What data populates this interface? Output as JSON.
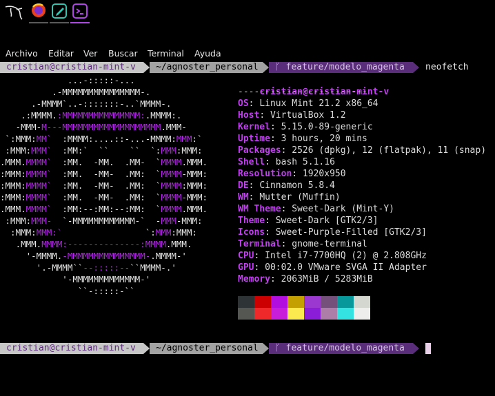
{
  "taskbar": {
    "items": [
      {
        "name": "kali-dragon-icon"
      },
      {
        "name": "firefox-icon"
      },
      {
        "name": "text-editor-icon"
      },
      {
        "name": "terminal-icon"
      }
    ]
  },
  "menu": {
    "items": [
      "Archivo",
      "Editar",
      "Ver",
      "Buscar",
      "Terminal",
      "Ayuda"
    ]
  },
  "prompt": {
    "user": "cristian@cristian-mint-v",
    "dir": "~/agnoster_personal",
    "branch_glyph": "ᚴ",
    "branch": "feature/modelo_magenta",
    "command": "neofetch"
  },
  "neofetch": {
    "title_user": "cristian@cristian-mint-v",
    "separator": "------------------------",
    "fields": [
      {
        "key": "OS",
        "value": "Linux Mint 21.2 x86_64"
      },
      {
        "key": "Host",
        "value": "VirtualBox 1.2"
      },
      {
        "key": "Kernel",
        "value": "5.15.0-89-generic"
      },
      {
        "key": "Uptime",
        "value": "3 hours, 20 mins"
      },
      {
        "key": "Packages",
        "value": "2526 (dpkg), 12 (flatpak), 11 (snap)"
      },
      {
        "key": "Shell",
        "value": "bash 5.1.16"
      },
      {
        "key": "Resolution",
        "value": "1920x950"
      },
      {
        "key": "DE",
        "value": "Cinnamon 5.8.4"
      },
      {
        "key": "WM",
        "value": "Mutter (Muffin)"
      },
      {
        "key": "WM Theme",
        "value": "Sweet-Dark (Mint-Y)"
      },
      {
        "key": "Theme",
        "value": "Sweet-Dark [GTK2/3]"
      },
      {
        "key": "Icons",
        "value": "Sweet-Purple-Filled [GTK2/3]"
      },
      {
        "key": "Terminal",
        "value": "gnome-terminal"
      },
      {
        "key": "CPU",
        "value": "Intel i7-7700HQ (2) @ 2.808GHz"
      },
      {
        "key": "GPU",
        "value": "00:02.0 VMware SVGA II Adapter"
      },
      {
        "key": "Memory",
        "value": "2063MiB / 5283MiB"
      }
    ],
    "palette_top": [
      "#2e3436",
      "#cc0000",
      "#b20ee0",
      "#c4a000",
      "#9a38d0",
      "#75507b",
      "#06989a",
      "#d3d7cf"
    ],
    "palette_bottom": [
      "#555753",
      "#ef2929",
      "#c81ed9",
      "#fce94f",
      "#8b1cd8",
      "#ad7fa8",
      "#34e2e2",
      "#eeeeec"
    ]
  },
  "logo": [
    [
      [
        "t",
        "             ...-:::::-..."
      ]
    ],
    [
      [
        "t",
        "          .-MMMMMMMMMMMMMMM-."
      ]
    ],
    [
      [
        "t",
        "      .-MMMM`..-:::::::-..`MMMM-."
      ]
    ],
    [
      [
        "t",
        "    .:MMMM."
      ],
      [
        "p",
        ":MMMMMMMMMMMMMMM:"
      ],
      [
        "t",
        ".MMMM:."
      ]
    ],
    [
      [
        "t",
        "   -MMM-"
      ],
      [
        "p",
        "M---MMMMMMMMMMMMMMMMMMM"
      ],
      [
        "t",
        ".MMM-"
      ]
    ],
    [
      [
        "t",
        " `:MMM:"
      ],
      [
        "p",
        "MM`"
      ],
      [
        "t",
        "  :MMMM:....::-...-MMMM:"
      ],
      [
        "p",
        "MMM"
      ],
      [
        "t",
        ":`"
      ]
    ],
    [
      [
        "t",
        " :MMM:"
      ],
      [
        "p",
        "MMM`"
      ],
      [
        "t",
        "  :MM:`  ``    ``  `:"
      ],
      [
        "p",
        "MMM"
      ],
      [
        "t",
        ":MMM:"
      ]
    ]
  ],
  "logo2": [
    [
      [
        "t",
        ".MMM."
      ],
      [
        "p",
        "MMMM`"
      ],
      [
        "t",
        "  :MM.  -MM.  .MM-  `"
      ],
      [
        "p",
        "MMMM"
      ],
      [
        "t",
        ".MMM."
      ]
    ],
    [
      [
        "t",
        ":MMM:"
      ],
      [
        "p",
        "MMMM`"
      ],
      [
        "t",
        "  :MM.  -MM-  .MM:  `"
      ],
      [
        "p",
        "MMMM"
      ],
      [
        "t",
        "-MMM:"
      ]
    ],
    [
      [
        "t",
        ":MMM:"
      ],
      [
        "p",
        "MMMM`"
      ],
      [
        "t",
        "  :MM.  -MM-  .MM:  `"
      ],
      [
        "p",
        "MMMM"
      ],
      [
        "t",
        ":MMM:"
      ]
    ],
    [
      [
        "t",
        ":MMM:"
      ],
      [
        "p",
        "MMMM`"
      ],
      [
        "t",
        "  :MM.  -MM-  .MM:  `"
      ],
      [
        "p",
        "MMMM"
      ],
      [
        "t",
        "-MMM:"
      ]
    ],
    [
      [
        "t",
        ".MMM."
      ],
      [
        "p",
        "MMMM`"
      ],
      [
        "t",
        "  :MM:--:MM:--:MM:  `"
      ],
      [
        "p",
        "MMMM"
      ],
      [
        "t",
        ".MMM."
      ]
    ],
    [
      [
        "t",
        " :MMM:"
      ],
      [
        "p",
        "MMM-"
      ],
      [
        "t",
        "  `-MMMMMMMMMMMM-`  -"
      ],
      [
        "p",
        "MMM"
      ],
      [
        "t",
        "-MMM:"
      ]
    ],
    [
      [
        "t",
        "  :MMM:"
      ],
      [
        "p",
        "MMM:`"
      ],
      [
        "t",
        "                `:"
      ],
      [
        "p",
        "MMM"
      ],
      [
        "t",
        ":MMM:"
      ]
    ],
    [
      [
        "t",
        "   .MMM."
      ],
      [
        "p",
        "MMMM:--------------:MMMM"
      ],
      [
        "t",
        ".MMM."
      ]
    ],
    [
      [
        "t",
        "     '-MMMM."
      ],
      [
        "p",
        "-MMMMMMMMMMMMMMM-"
      ],
      [
        "t",
        ".MMMM-'"
      ]
    ],
    [
      [
        "t",
        "       '.-MMMM``"
      ],
      [
        "p",
        "--:::::--"
      ],
      [
        "t",
        "``MMMM-.'"
      ]
    ],
    [
      [
        "t",
        "            '-MMMMMMMMMMMMM-'"
      ]
    ],
    [
      [
        "t",
        "               ``-:::::-``"
      ]
    ]
  ]
}
